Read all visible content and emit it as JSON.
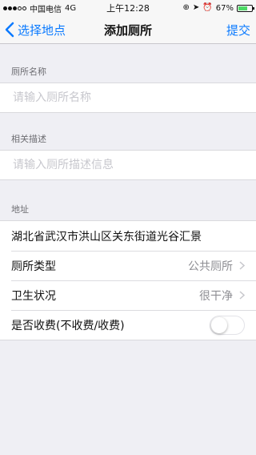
{
  "status_bar": {
    "carrier": "中国电信",
    "network": "4G",
    "time": "上午12:28",
    "battery_percent": "67%",
    "battery_level": 0.67
  },
  "nav": {
    "back_label": "选择地点",
    "title": "添加厕所",
    "submit_label": "提交"
  },
  "sections": {
    "name": {
      "header": "厕所名称",
      "placeholder": "请输入厕所名称"
    },
    "description": {
      "header": "相关描述",
      "placeholder": "请输入厕所描述信息"
    },
    "address": {
      "header": "地址",
      "address_text": "湖北省武汉市洪山区关东街道光谷汇景",
      "type_label": "厕所类型",
      "type_value": "公共厕所",
      "hygiene_label": "卫生状况",
      "hygiene_value": "很干净",
      "fee_label": "是否收费(不收费/收费)",
      "fee_enabled": false
    }
  },
  "colors": {
    "accent": "#0a7aff",
    "background": "#efeff4",
    "placeholder": "#c7c7cd",
    "secondary_text": "#8e8e93"
  }
}
